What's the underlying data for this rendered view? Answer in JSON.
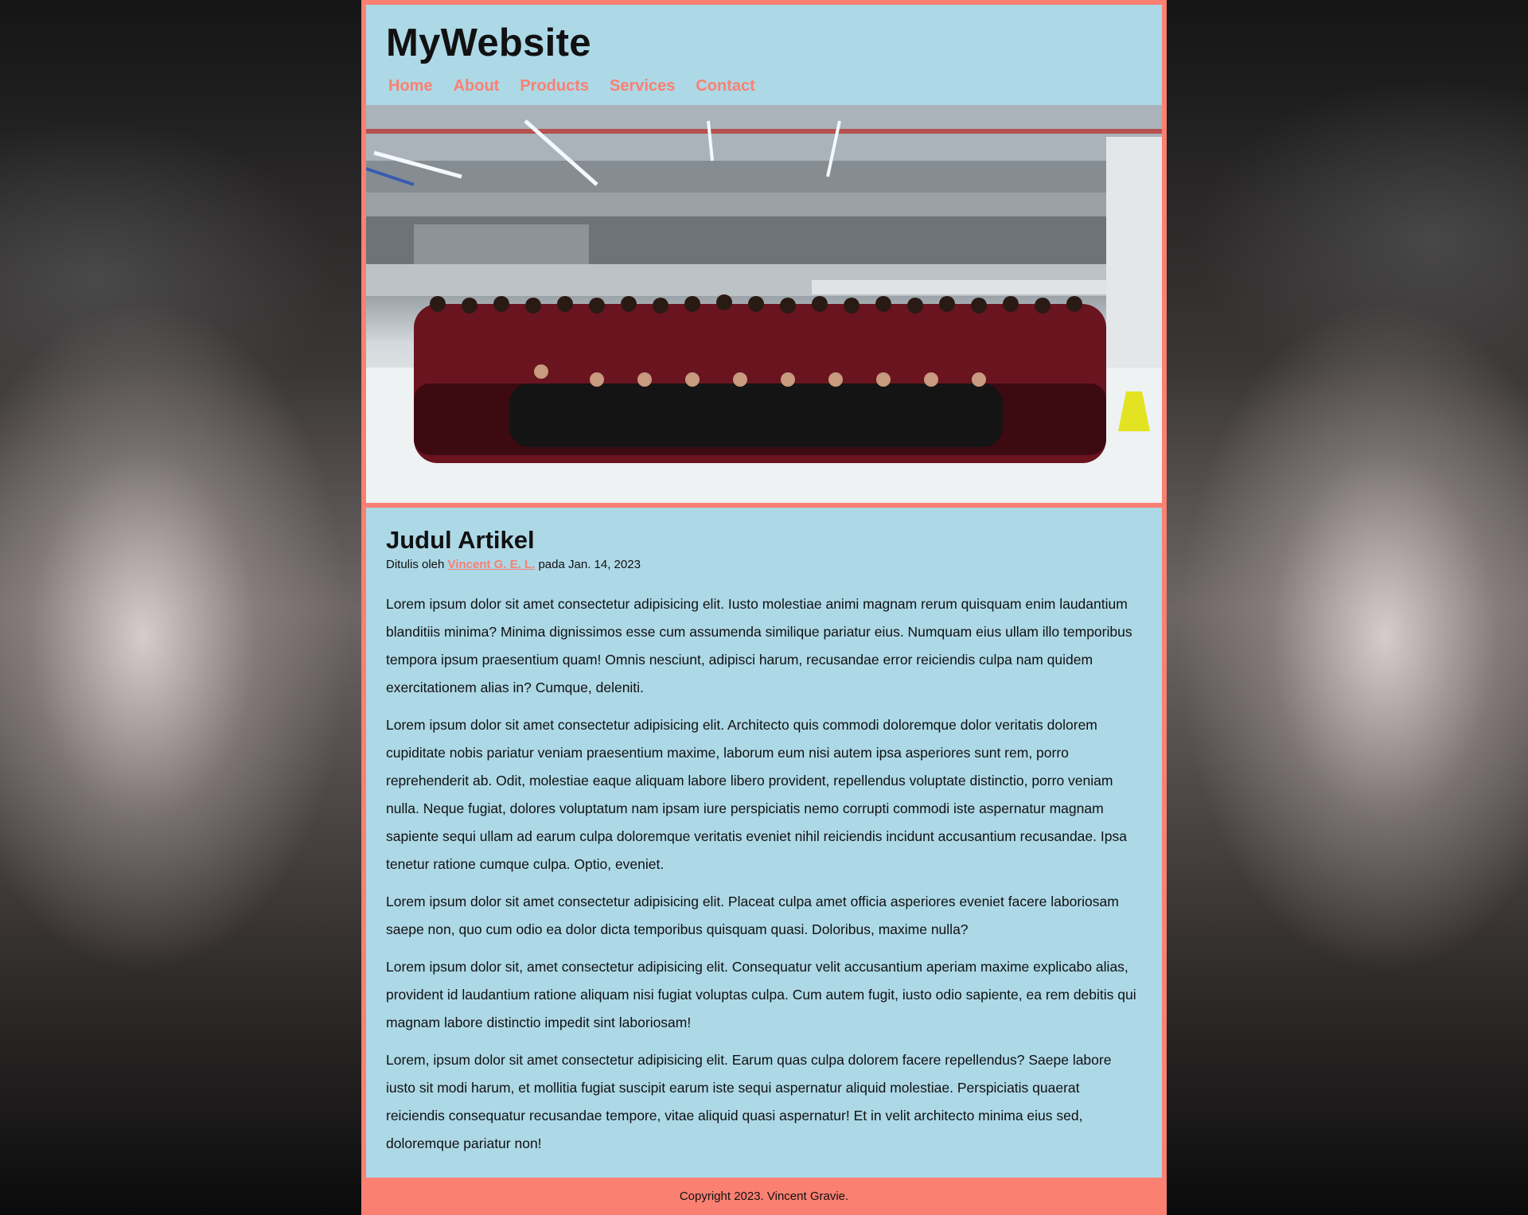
{
  "site": {
    "title": "MyWebsite"
  },
  "nav": {
    "items": [
      "Home",
      "About",
      "Products",
      "Services",
      "Contact"
    ]
  },
  "hero": {
    "image_name": "group-photo-choir"
  },
  "article": {
    "title": "Judul Artikel",
    "byline_prefix": "Ditulis oleh",
    "author": "Vincent G. E. L.",
    "byline_suffix": "pada Jan. 14, 2023",
    "paragraphs": [
      "Lorem ipsum dolor sit amet consectetur adipisicing elit. Iusto molestiae animi magnam rerum quisquam enim laudantium blanditiis minima? Minima dignissimos esse cum assumenda similique pariatur eius. Numquam eius ullam illo temporibus tempora ipsum praesentium quam! Omnis nesciunt, adipisci harum, recusandae error reiciendis culpa nam quidem exercitationem alias in? Cumque, deleniti.",
      "Lorem ipsum dolor sit amet consectetur adipisicing elit. Architecto quis commodi doloremque dolor veritatis dolorem cupiditate nobis pariatur veniam praesentium maxime, laborum eum nisi autem ipsa asperiores sunt rem, porro reprehenderit ab. Odit, molestiae eaque aliquam labore libero provident, repellendus voluptate distinctio, porro veniam nulla. Neque fugiat, dolores voluptatum nam ipsam iure perspiciatis nemo corrupti commodi iste aspernatur magnam sapiente sequi ullam ad earum culpa doloremque veritatis eveniet nihil reiciendis incidunt accusantium recusandae. Ipsa tenetur ratione cumque culpa. Optio, eveniet.",
      "Lorem ipsum dolor sit amet consectetur adipisicing elit. Placeat culpa amet officia asperiores eveniet facere laboriosam saepe non, quo cum odio ea dolor dicta temporibus quisquam quasi. Doloribus, maxime nulla?",
      "Lorem ipsum dolor sit, amet consectetur adipisicing elit. Consequatur velit accusantium aperiam maxime explicabo alias, provident id laudantium ratione aliquam nisi fugiat voluptas culpa. Cum autem fugit, iusto odio sapiente, ea rem debitis qui magnam labore distinctio impedit sint laboriosam!",
      "Lorem, ipsum dolor sit amet consectetur adipisicing elit. Earum quas culpa dolorem facere repellendus? Saepe labore iusto sit modi harum, et mollitia fugiat suscipit earum iste sequi aspernatur aliquid molestiae. Perspiciatis quaerat reiciendis consequatur recusandae tempore, vitae aliquid quasi aspernatur! Et in velit architecto minima eius sed, doloremque pariatur non!"
    ]
  },
  "footer": {
    "text": "Copyright 2023. Vincent Gravie."
  }
}
